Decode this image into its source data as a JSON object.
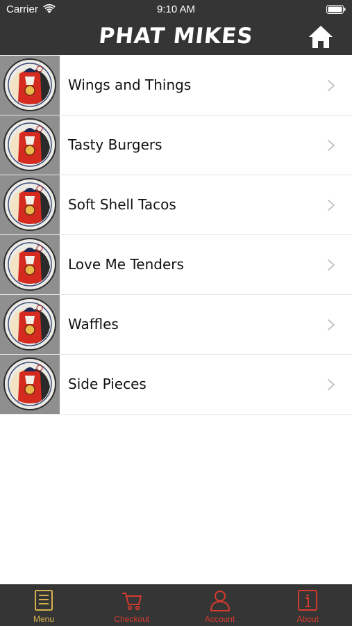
{
  "status": {
    "carrier": "Carrier",
    "time": "9:10 AM"
  },
  "nav": {
    "title": "PHAT MIKES",
    "home_icon": "home-icon"
  },
  "menu": {
    "items": [
      {
        "label": "Wings and Things"
      },
      {
        "label": "Tasty Burgers"
      },
      {
        "label": "Soft Shell Tacos"
      },
      {
        "label": "Love Me Tenders"
      },
      {
        "label": "Waffles"
      },
      {
        "label": "Side Pieces"
      }
    ]
  },
  "tabs": [
    {
      "label": "Menu",
      "icon": "menu-book-icon",
      "active": true
    },
    {
      "label": "Checkout",
      "icon": "cart-icon",
      "active": false
    },
    {
      "label": "Account",
      "icon": "person-icon",
      "active": false
    },
    {
      "label": "About",
      "icon": "info-icon",
      "active": false
    }
  ],
  "colors": {
    "bar": "#363535",
    "active_tab": "#d4b24c",
    "inactive_tab": "#d43b2f"
  }
}
